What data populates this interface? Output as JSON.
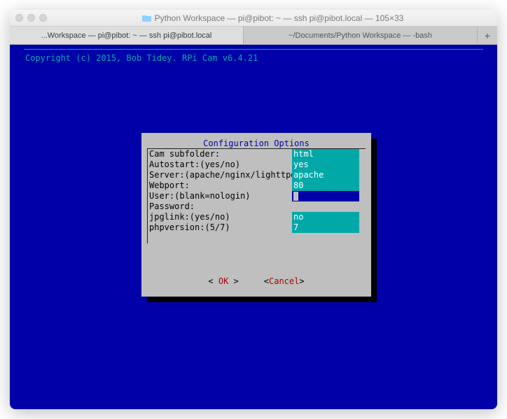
{
  "window": {
    "title": "Python Workspace — pi@pibot: ~ — ssh pi@pibot.local — 105×33"
  },
  "tabs": [
    {
      "label": "...Workspace — pi@pibot: ~ — ssh pi@pibot.local"
    },
    {
      "label": "~/Documents/Python Workspace — -bash"
    }
  ],
  "terminal": {
    "copyright": "Copyright (c) 2015, Bob Tidey. RPi Cam v6.4.21"
  },
  "dialog": {
    "title": "Configuration Options",
    "fields": [
      {
        "label": "Cam subfolder:",
        "value": "html",
        "active": false
      },
      {
        "label": "Autostart:(yes/no)",
        "value": "yes",
        "active": false
      },
      {
        "label": "Server:(apache/nginx/lighttpd)",
        "value": "apache",
        "active": false
      },
      {
        "label": "Webport:",
        "value": "80",
        "active": false
      },
      {
        "label": "User:(blank=nologin)",
        "value": "",
        "active": true
      },
      {
        "label": "Password:",
        "value": "",
        "active": false,
        "nobg": true
      },
      {
        "label": "jpglink:(yes/no)",
        "value": "no",
        "active": false
      },
      {
        "label": "phpversion:(5/7)",
        "value": "7",
        "active": false
      }
    ],
    "ok": "OK",
    "cancel": "Cancel"
  }
}
